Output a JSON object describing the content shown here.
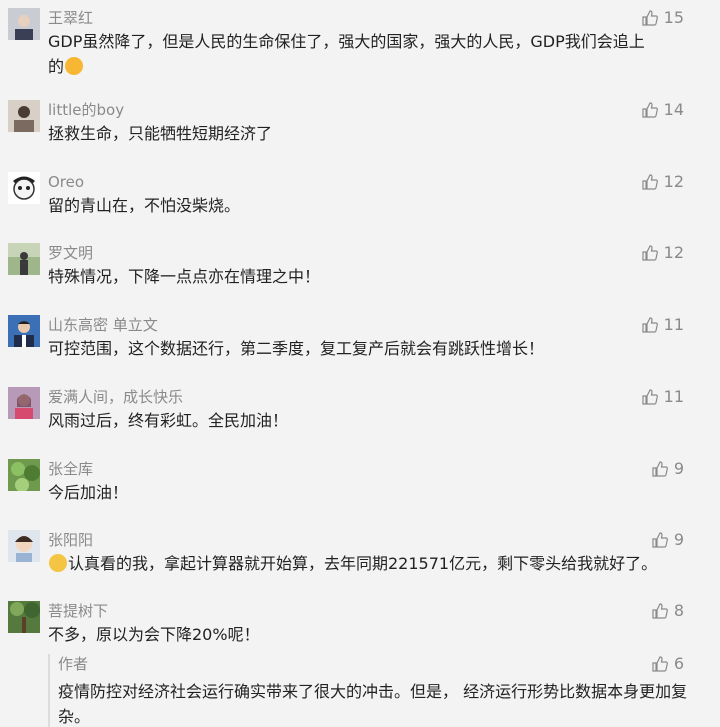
{
  "comments": [
    {
      "name": "王翠红",
      "likes": "15",
      "text_a": "GDP虽然降了，但是人民的生命保住了，强大的国家，强大的人民",
      "text_b": "，GDP我们会追上",
      "text_c": "的"
    },
    {
      "name": "little的boy",
      "likes": "14",
      "text": "拯救生命，只能牺牲短期经济了"
    },
    {
      "name": "Oreo",
      "likes": "12",
      "text": "留的青山在，不怕没柴烧。"
    },
    {
      "name": "罗文明",
      "likes": "12",
      "text": "特殊情况，下降一点点亦在情理之中！"
    },
    {
      "name": "山东高密 单立文",
      "likes": "11",
      "text": "可控范围，这个数据还行，第二季度，复工复产后就会有跳跃性增长！"
    },
    {
      "name": "爱满人间，成长快乐",
      "likes": "11",
      "text": "风雨过后，终有彩虹。全民加油！"
    },
    {
      "name": "张全库",
      "likes": "9",
      "text": "今后加油！"
    },
    {
      "name": "张阳阳",
      "likes": "9",
      "text": "认真看的我，拿起计算器就开始算，去年同期221571亿元，剩下零头给我就好了。"
    },
    {
      "name": "菩提树下",
      "likes": "8",
      "text": "不多，原以为会下降20%呢！"
    }
  ],
  "author_reply": {
    "name": "作者",
    "likes": "6",
    "text": "疫情防控对经济社会运行确实带来了很大的冲击。但是， 经济运行形势比数据本身更加复杂。"
  },
  "icons": {
    "like": "thumbs-up-icon",
    "emoji_smile": "smile-emoji-icon",
    "emoji_wow": "wow-emoji-icon"
  },
  "colors": {
    "background": "#f3f3f3",
    "name": "#8a8a8a",
    "text": "#222222"
  }
}
